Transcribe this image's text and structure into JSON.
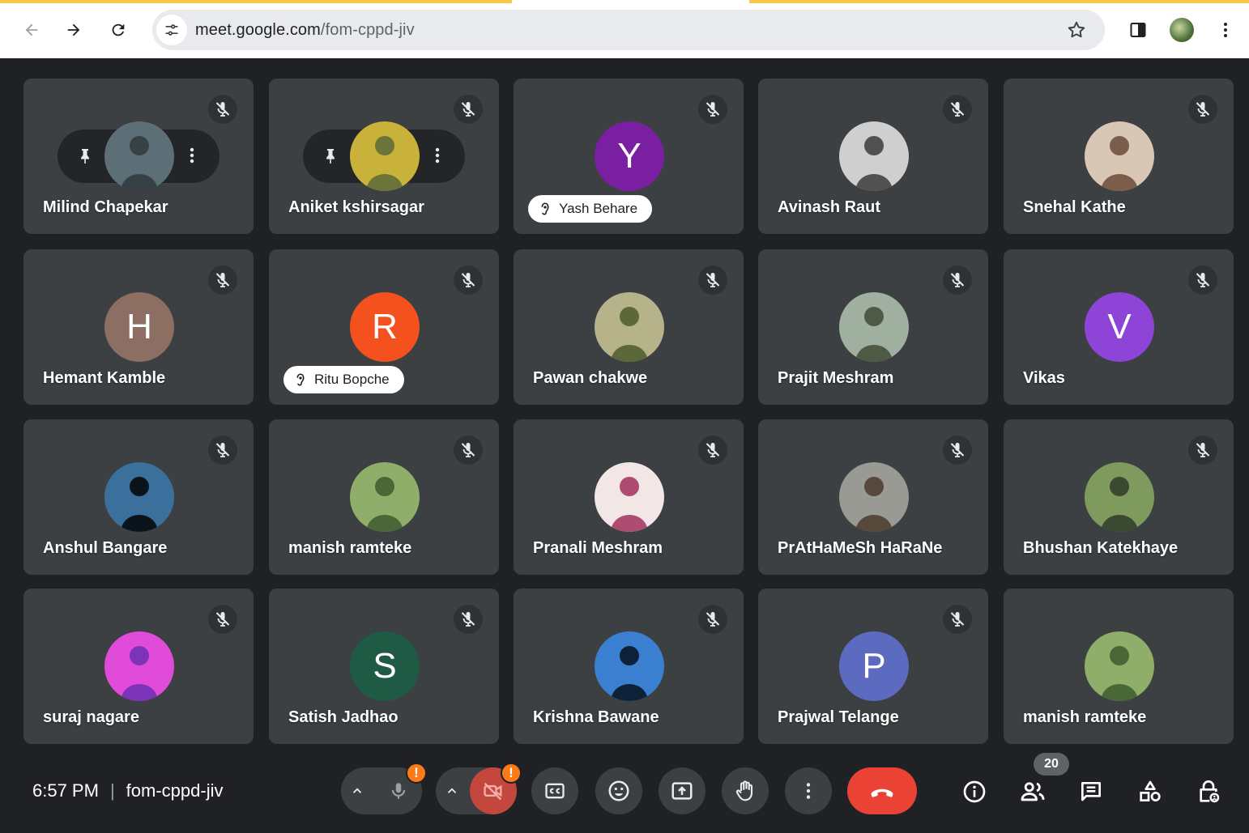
{
  "browser": {
    "url_host": "meet.google.com",
    "url_path": "/fom-cppd-jiv"
  },
  "participants": [
    {
      "name": "Milind Chapekar",
      "avatar_type": "photo",
      "photo_colors": [
        "#5d6f76",
        "#2f3a3e"
      ],
      "hover_controls": true,
      "speaking": false
    },
    {
      "name": "Aniket kshirsagar",
      "avatar_type": "photo",
      "photo_colors": [
        "#c9b23a",
        "#5a6a3a"
      ],
      "hover_controls": true,
      "speaking": false
    },
    {
      "name": "Yash Behare",
      "avatar_type": "letter",
      "initial": "Y",
      "color": "#7b1fa2",
      "speaking": true
    },
    {
      "name": "Avinash Raut",
      "avatar_type": "photo",
      "photo_colors": [
        "#cfcfcf",
        "#3b3b3b"
      ],
      "speaking": false
    },
    {
      "name": "Snehal Kathe",
      "avatar_type": "photo",
      "photo_colors": [
        "#d9c7b5",
        "#6b4a3a"
      ],
      "speaking": false
    },
    {
      "name": "Hemant Kamble",
      "avatar_type": "letter",
      "initial": "H",
      "color": "#8d6e63",
      "speaking": false
    },
    {
      "name": "Ritu Bopche",
      "avatar_type": "letter",
      "initial": "R",
      "color": "#f4511e",
      "speaking": true
    },
    {
      "name": "Pawan chakwe",
      "avatar_type": "photo",
      "photo_colors": [
        "#b6b28a",
        "#4d5b2c"
      ],
      "speaking": false
    },
    {
      "name": "Prajit Meshram",
      "avatar_type": "photo",
      "photo_colors": [
        "#9fb0a0",
        "#3f4b36"
      ],
      "speaking": false
    },
    {
      "name": "Vikas",
      "avatar_type": "letter",
      "initial": "V",
      "color": "#8e44d6",
      "speaking": false
    },
    {
      "name": "Anshul Bangare",
      "avatar_type": "photo",
      "photo_colors": [
        "#3b6f9c",
        "#050505"
      ],
      "speaking": false
    },
    {
      "name": "manish ramteke",
      "avatar_type": "photo",
      "photo_colors": [
        "#8fae6a",
        "#3e5a2e"
      ],
      "speaking": false
    },
    {
      "name": "Pranali Meshram",
      "avatar_type": "photo",
      "photo_colors": [
        "#f2e6e6",
        "#a1305a"
      ],
      "speaking": false
    },
    {
      "name": "PrAtHaMeSh HaRaNe",
      "avatar_type": "photo",
      "photo_colors": [
        "#9a9a94",
        "#4a3a2a"
      ],
      "speaking": false
    },
    {
      "name": "Bhushan Katekhaye",
      "avatar_type": "photo",
      "photo_colors": [
        "#7e9a5c",
        "#2f3a2a"
      ],
      "speaking": false
    },
    {
      "name": "suraj nagare",
      "avatar_type": "photo",
      "photo_colors": [
        "#e04bd9",
        "#6a2fb0"
      ],
      "speaking": false
    },
    {
      "name": "Satish Jadhao",
      "avatar_type": "letter",
      "initial": "S",
      "color": "#1e5a44",
      "speaking": false
    },
    {
      "name": "Krishna Bawane",
      "avatar_type": "photo",
      "photo_colors": [
        "#3a7fd0",
        "#07101f"
      ],
      "speaking": false
    },
    {
      "name": "Prajwal Telange",
      "avatar_type": "letter",
      "initial": "P",
      "color": "#5c6bc0",
      "speaking": false
    },
    {
      "name": "manish ramteke",
      "avatar_type": "photo",
      "photo_colors": [
        "#8fae6a",
        "#3e5a2e"
      ],
      "speaking": false,
      "no_mute_icon": true
    }
  ],
  "bottom_bar": {
    "time": "6:57 PM",
    "meeting_code": "fom-cppd-jiv",
    "mic_badge": "!",
    "cam_badge": "!",
    "participant_count": "20"
  },
  "colors": {
    "background": "#202124",
    "tile": "#3c4043",
    "end_call": "#ea4335",
    "warning_badge": "#fa7b17"
  }
}
